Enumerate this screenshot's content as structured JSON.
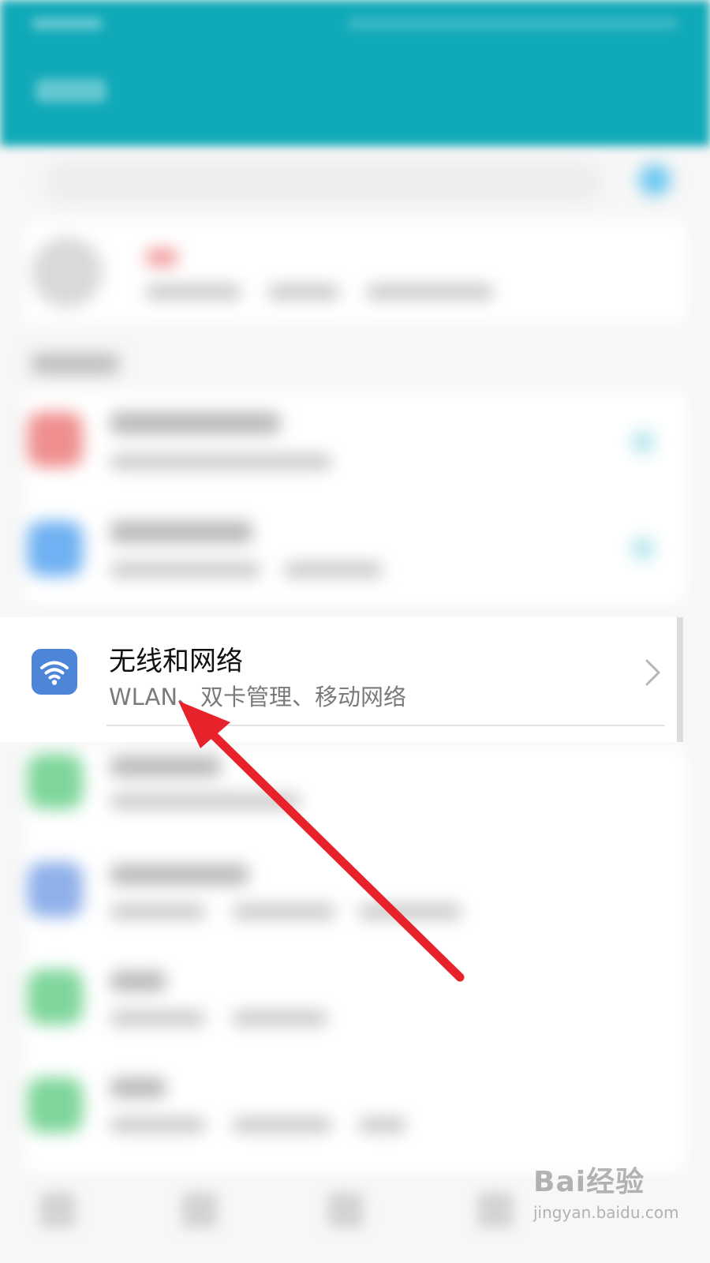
{
  "settings_item": {
    "title": "无线和网络",
    "subtitle": "WLAN、双卡管理、移动网络"
  },
  "watermark": {
    "brand": "Bai经验",
    "url": "jingyan.baidu.com"
  },
  "colors": {
    "header": "#10a9b8",
    "wifi_icon_bg": "#4d86d9",
    "arrow": "#e8222a"
  },
  "icons": [
    "wifi-icon",
    "chevron-right-icon"
  ]
}
